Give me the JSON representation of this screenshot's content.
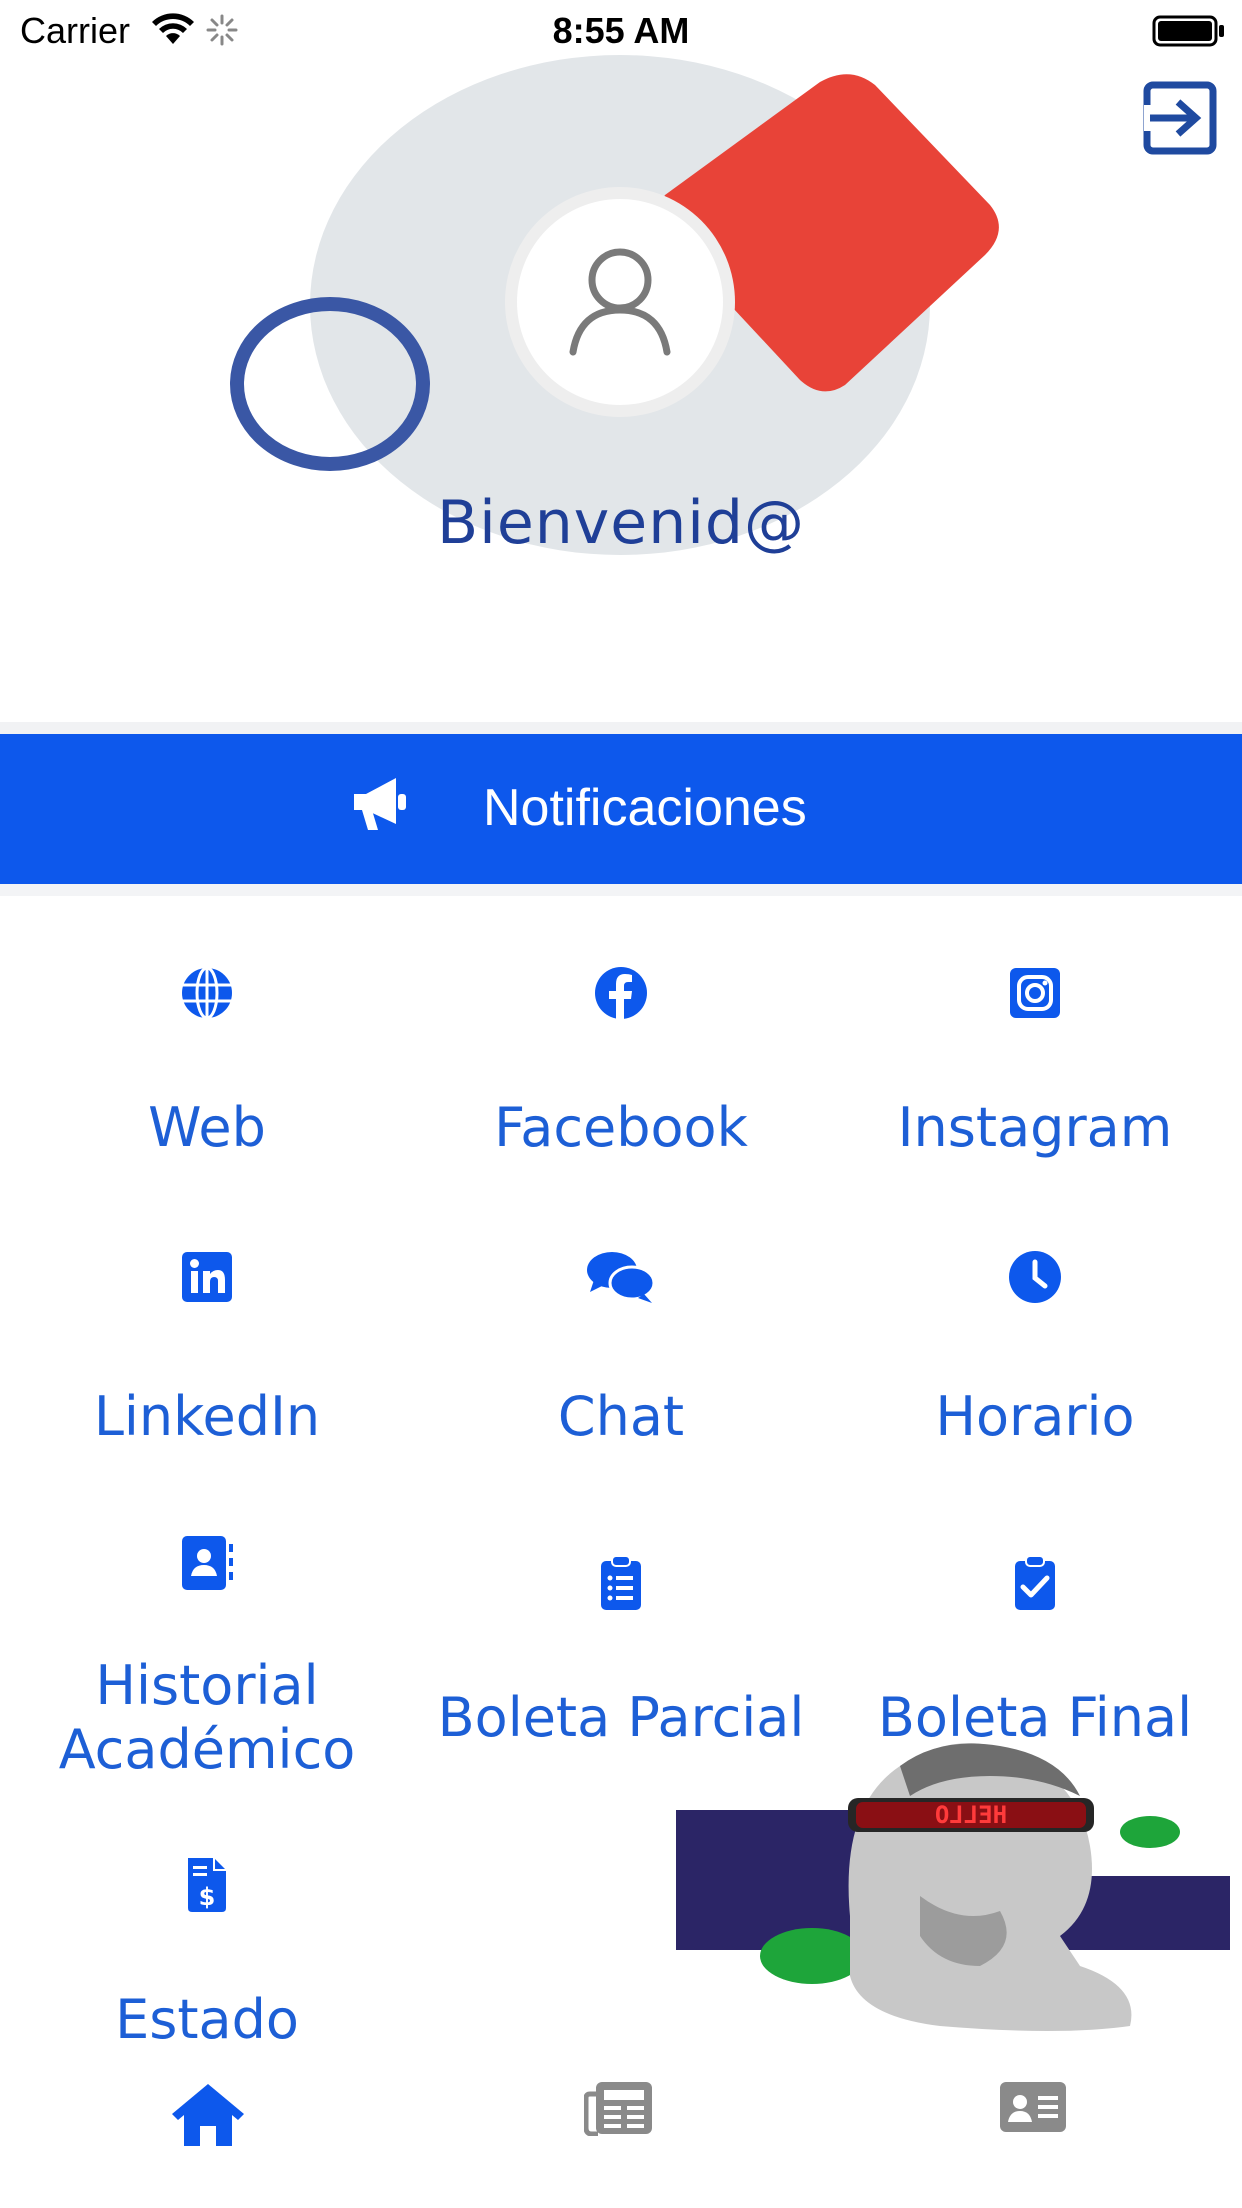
{
  "status_bar": {
    "carrier": "Carrier",
    "time": "8:55 AM"
  },
  "header": {
    "welcome": "Bienvenid@"
  },
  "notifications": {
    "label": "Notificaciones"
  },
  "menu": [
    {
      "label": "Web",
      "icon": "globe-icon"
    },
    {
      "label": "Facebook",
      "icon": "facebook-icon"
    },
    {
      "label": "Instagram",
      "icon": "instagram-icon"
    },
    {
      "label": "LinkedIn",
      "icon": "linkedin-icon"
    },
    {
      "label": "Chat",
      "icon": "chat-icon"
    },
    {
      "label": "Horario",
      "icon": "clock-icon"
    },
    {
      "label_line1": "Historial",
      "label_line2": "Académico",
      "icon": "contact-book-icon"
    },
    {
      "label": "Boleta Parcial",
      "icon": "clipboard-list-icon"
    },
    {
      "label": "Boleta Final",
      "icon": "clipboard-check-icon"
    },
    {
      "label": "Estado",
      "icon": "invoice-dollar-icon"
    }
  ],
  "decoration": {
    "sign_text": "HELLO"
  },
  "tabs": [
    {
      "name": "home",
      "icon": "home-icon",
      "active": true
    },
    {
      "name": "news",
      "icon": "newspaper-icon",
      "active": false
    },
    {
      "name": "profile",
      "icon": "id-card-icon",
      "active": false
    }
  ],
  "colors": {
    "primary": "#0d58ec",
    "label": "#1d5fd6",
    "welcome": "#1f3f97",
    "accent_red": "#e84338",
    "inactive_tab": "#8a8a8a"
  }
}
